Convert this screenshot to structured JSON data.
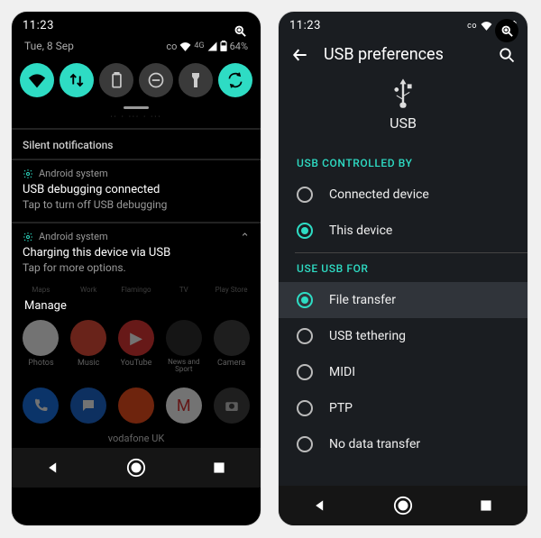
{
  "status": {
    "time": "11:23",
    "battery": "64%",
    "signal_label": "4G",
    "carrier_glyph": "co"
  },
  "left": {
    "date": "Tue, 8 Sep",
    "toggles": [
      {
        "name": "wifi",
        "on": true
      },
      {
        "name": "data",
        "on": true
      },
      {
        "name": "battery-saver",
        "on": false
      },
      {
        "name": "dnd",
        "on": false
      },
      {
        "name": "flashlight",
        "on": false
      },
      {
        "name": "auto-rotate",
        "on": true
      }
    ],
    "silent_label": "Silent notifications",
    "notifications": [
      {
        "source": "Android system",
        "title": "USB debugging connected",
        "body": "Tap to turn off USB debugging"
      },
      {
        "source": "Android system",
        "title": "Charging this device via USB",
        "body": "Tap for more options."
      }
    ],
    "partial_labels": [
      "Maps",
      "Work",
      "Flamingo",
      "TV",
      "Play Store"
    ],
    "manage_label": "Manage",
    "apps": [
      {
        "label": "Photos",
        "bg": "#fff"
      },
      {
        "label": "Music",
        "bg": "#e94e3a"
      },
      {
        "label": "YouTube",
        "bg": "#e53935"
      },
      {
        "label": "News and Sport",
        "bg": "#2f2f2f"
      },
      {
        "label": "Camera",
        "bg": "#444"
      }
    ],
    "dock_apps": [
      {
        "name": "phone",
        "bg": "#1a73e8"
      },
      {
        "name": "messages",
        "bg": "#1e6bd6"
      },
      {
        "name": "brave",
        "bg": "#f4511e"
      },
      {
        "name": "gmail",
        "bg": "#fff"
      },
      {
        "name": "camera",
        "bg": "#444"
      }
    ],
    "carrier": "vodafone UK"
  },
  "right": {
    "title": "USB preferences",
    "hero_label": "USB",
    "group1": {
      "label": "USB CONTROLLED BY",
      "options": [
        "Connected device",
        "This device"
      ],
      "selected": 1
    },
    "group2": {
      "label": "USE USB FOR",
      "options": [
        "File transfer",
        "USB tethering",
        "MIDI",
        "PTP",
        "No data transfer"
      ],
      "selected": 0
    }
  }
}
